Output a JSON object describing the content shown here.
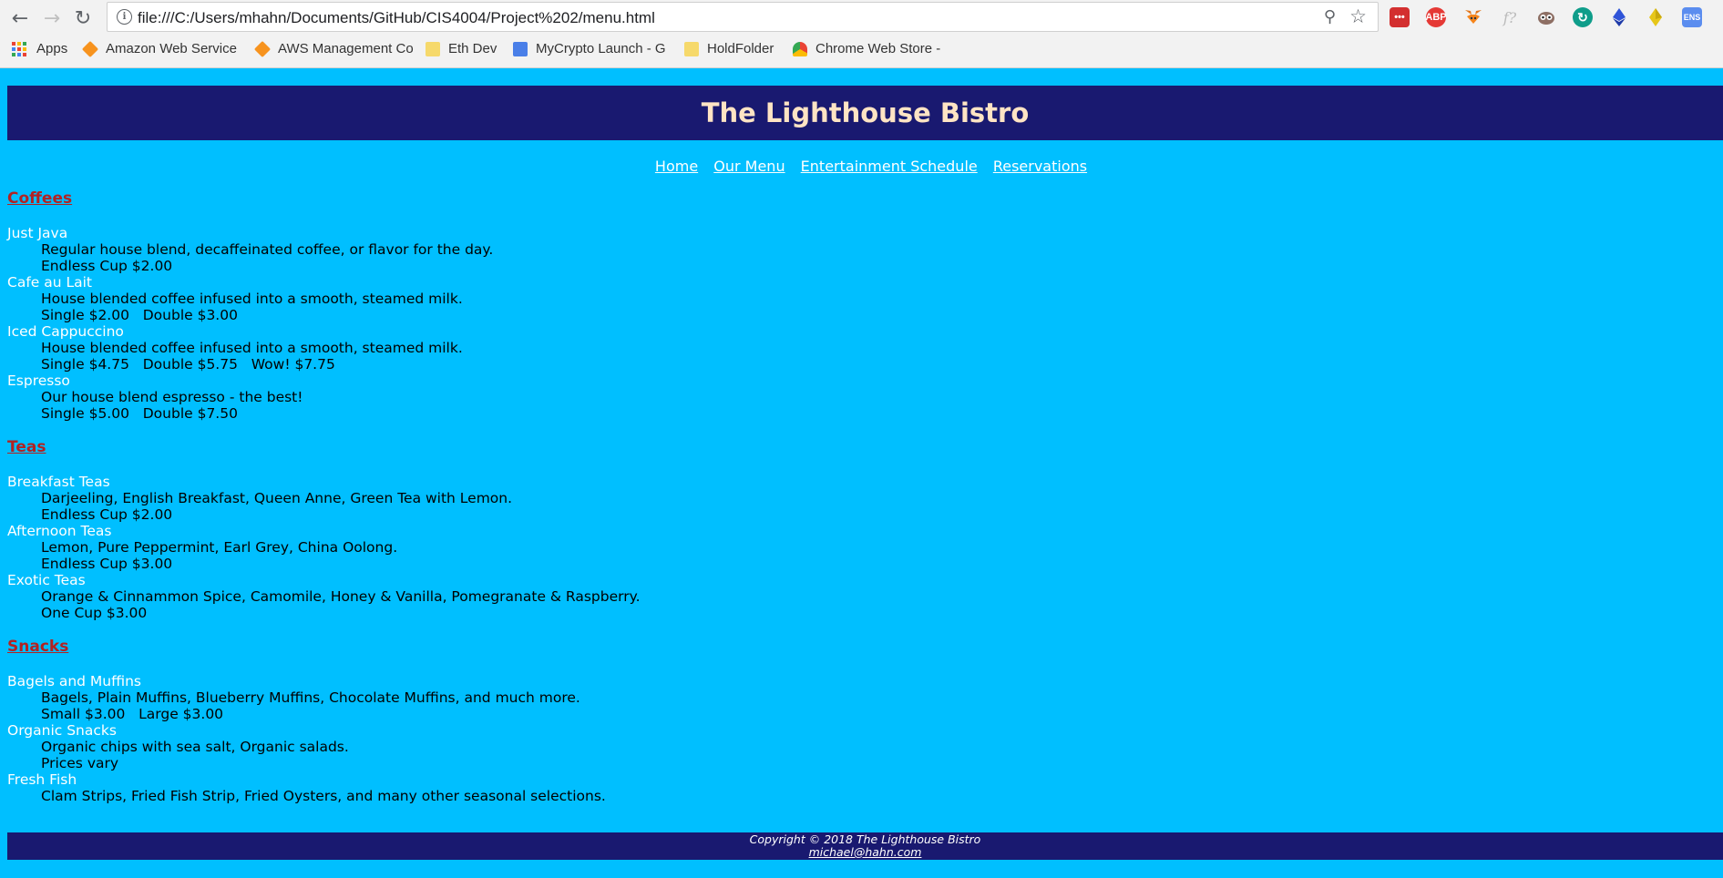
{
  "browser": {
    "url": "file:///C:/Users/mhahn/Documents/GitHub/CIS4004/Project%202/menu.html",
    "extensions": [
      "lastpass-icon",
      "adblock-plus-icon",
      "metamask-icon",
      "formula-icon",
      "owl-icon",
      "refresh-ext-icon",
      "ethereum-icon",
      "diamond-icon",
      "ens-icon"
    ],
    "extension_labels": {
      "adblock": "ABP",
      "ens": "ENS",
      "lastpass": "•••",
      "formula": "f?"
    },
    "bookmarks": [
      {
        "label": "Apps",
        "icon": "apps-grid-icon"
      },
      {
        "label": "Amazon Web Service",
        "icon": "aws-cube-icon"
      },
      {
        "label": "AWS Management Co",
        "icon": "aws-cube-icon"
      },
      {
        "label": "Eth Dev",
        "icon": "folder-icon"
      },
      {
        "label": "MyCrypto Launch - G",
        "icon": "docs-icon"
      },
      {
        "label": "HoldFolder",
        "icon": "folder-icon"
      },
      {
        "label": "Chrome Web Store -",
        "icon": "chrome-store-icon"
      }
    ]
  },
  "site": {
    "title": "The Lighthouse Bistro",
    "nav": [
      "Home",
      "Our Menu",
      "Entertainment Schedule",
      "Reservations"
    ]
  },
  "menu": {
    "coffees": {
      "title": "Coffees",
      "items": [
        {
          "name": "Just Java",
          "desc": "Regular house blend, decaffeinated coffee, or flavor for the day.",
          "price": "Endless Cup $2.00"
        },
        {
          "name": "Cafe au Lait",
          "desc": "House blended coffee infused into a smooth, steamed milk.",
          "price": "Single $2.00   Double $3.00"
        },
        {
          "name": "Iced Cappuccino",
          "desc": "House blended coffee infused into a smooth, steamed milk.",
          "price": "Single $4.75   Double $5.75   Wow! $7.75"
        },
        {
          "name": "Espresso",
          "desc": "Our house blend espresso - the best!",
          "price": "Single $5.00   Double $7.50"
        }
      ]
    },
    "teas": {
      "title": "Teas",
      "items": [
        {
          "name": "Breakfast Teas",
          "desc": "Darjeeling, English Breakfast, Queen Anne, Green Tea with Lemon.",
          "price": "Endless Cup $2.00"
        },
        {
          "name": "Afternoon Teas",
          "desc": "Lemon, Pure Peppermint, Earl Grey, China Oolong.",
          "price": "Endless Cup $3.00"
        },
        {
          "name": "Exotic Teas",
          "desc": "Orange & Cinnammon Spice, Camomile, Honey & Vanilla, Pomegranate & Raspberry.",
          "price": "One Cup $3.00"
        }
      ]
    },
    "snacks": {
      "title": "Snacks",
      "items": [
        {
          "name": "Bagels and Muffins",
          "desc": "Bagels, Plain Muffins, Blueberry Muffins, Chocolate Muffins, and much more.",
          "price": "Small $3.00   Large $3.00"
        },
        {
          "name": "Organic Snacks",
          "desc": "Organic chips with sea salt, Organic salads.",
          "price": "Prices vary"
        },
        {
          "name": "Fresh Fish",
          "desc": "Clam Strips, Fried Fish Strip, Fried Oysters, and many other seasonal selections."
        }
      ]
    }
  },
  "footer": {
    "copyright": "Copyright © 2018 The Lighthouse Bistro",
    "email": "michael@hahn.com"
  },
  "colors": {
    "page_bg": "#00bfff",
    "header_bg": "#191970",
    "title_text": "#ffe4c4",
    "section_heading": "#b22222"
  }
}
